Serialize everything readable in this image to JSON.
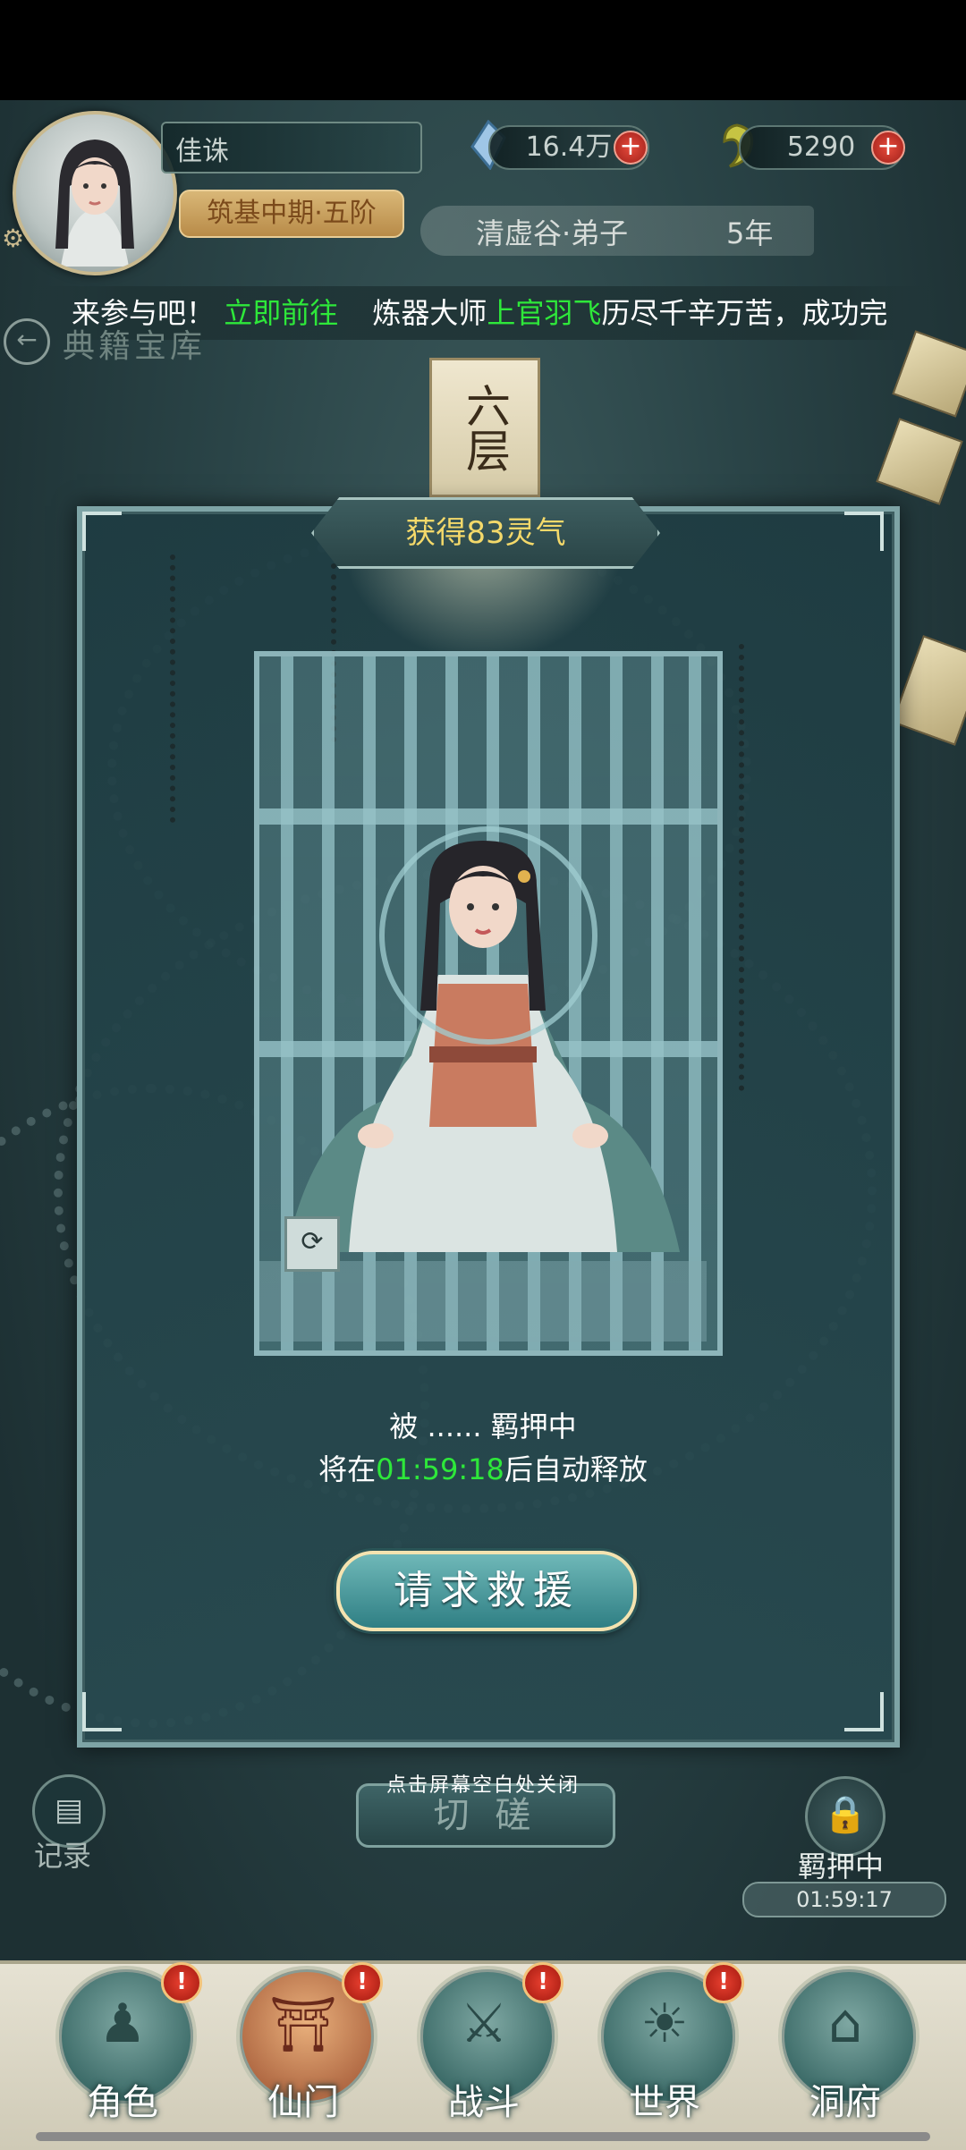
{
  "header": {
    "player_name": "佳诛",
    "rank": "筑基中期·五阶",
    "spirit_stones": "16.4万",
    "jade": "5290",
    "plus_symbol": "+",
    "sect": "清虚谷·弟子",
    "years": "5年"
  },
  "marquee": {
    "part1": "来参与吧！",
    "link": "立即前往",
    "part2": "炼器大师",
    "highlight_name": "上官羽飞",
    "part3": "历尽千辛万苦，成功完"
  },
  "nav_top": {
    "back_icon": "back-arrow-icon",
    "library_title": "典籍宝库",
    "floor_plaque": "六层"
  },
  "modal": {
    "reward": "获得83灵气",
    "captive_status": "被 ...... 羁押中",
    "release_prefix": "将在",
    "release_time": "01:59:18",
    "release_suffix": "后自动释放",
    "rescue_button": "请求救援"
  },
  "below_modal": {
    "close_hint": "点击屏幕空白处关闭",
    "spar_button": "切 磋",
    "record_label": "记录",
    "detain_label": "羁押中",
    "detain_timer": "01:59:17"
  },
  "bottom_nav": {
    "items": [
      {
        "label": "角色",
        "icon": "character-icon",
        "badge": "!"
      },
      {
        "label": "仙门",
        "icon": "sect-banner-icon",
        "badge": "!"
      },
      {
        "label": "战斗",
        "icon": "sword-icon",
        "badge": "!"
      },
      {
        "label": "世界",
        "icon": "world-icon",
        "badge": "!"
      },
      {
        "label": "洞府",
        "icon": "pavilion-icon",
        "badge": ""
      }
    ]
  },
  "colors": {
    "accent_green": "#2ee83a",
    "reward_gold": "#f4d96a",
    "badge_red": "#e94030"
  }
}
